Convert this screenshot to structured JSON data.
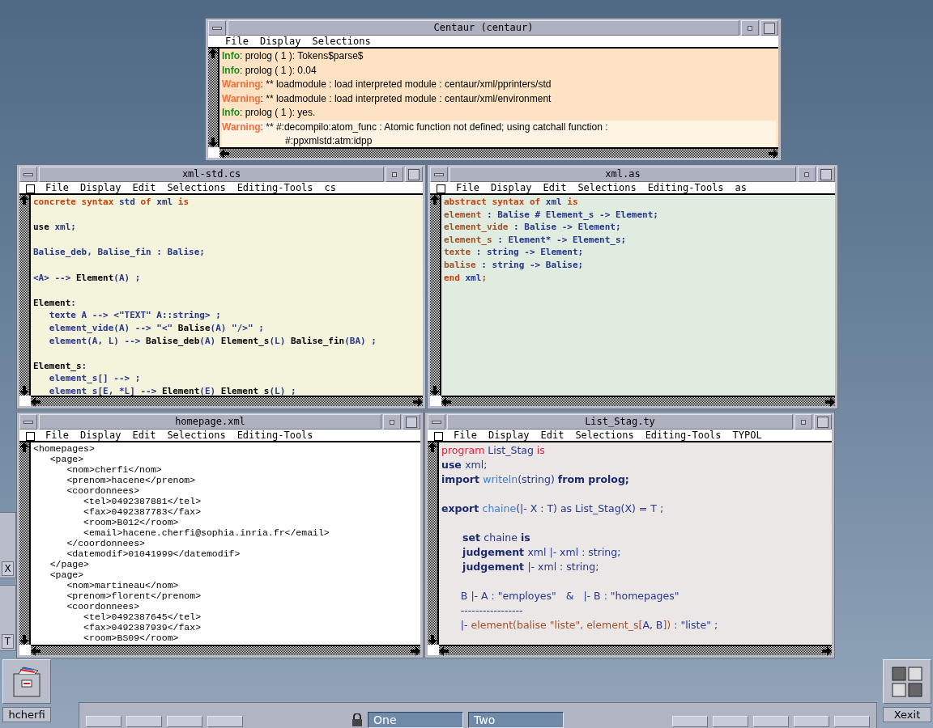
{
  "windows": [
    {
      "title": "Centaur (centaur)",
      "kind": "log",
      "color": "#fde3c4",
      "menu": [
        "File",
        "Display",
        "Selections"
      ],
      "entries": [
        {
          "kind": "info",
          "label": "Info",
          "message": ": prolog ( 1 ): Tokens$parse$",
          "selected": false
        },
        {
          "kind": "info",
          "label": "Info",
          "message": ": prolog ( 1 ): 0.04",
          "selected": false
        },
        {
          "kind": "warning",
          "label": "Warning",
          "message": ": ** loadmodule : load interpreted module : centaur/xml/pprinters/std",
          "selected": false
        },
        {
          "kind": "warning",
          "label": "Warning",
          "message": ": ** loadmodule : load interpreted module : centaur/xml/environment",
          "selected": false
        },
        {
          "kind": "info",
          "label": "Info",
          "message": ": prolog ( 1 ): yes.",
          "selected": false
        },
        {
          "kind": "warning",
          "label": "Warning",
          "message": ": ** #:decompilo:atom_func : Atomic function not defined; using catchall function :",
          "continuation": "#:ppxmlstd:atm:idpp",
          "selected": true
        }
      ]
    },
    {
      "title": "xml-std.cs",
      "kind": "code",
      "color": "#f4f3dc",
      "toggle": {
        "checked": false
      },
      "menu": [
        "File",
        "Display",
        "Edit",
        "Selections",
        "Editing-Tools",
        "cs"
      ],
      "lines": [
        {
          "kind": "text",
          "segments": [
            {
              "kind": "keyword",
              "text": "concrete syntax "
            },
            {
              "kind": "name",
              "text": "std "
            },
            {
              "kind": "keyword",
              "text": "of "
            },
            {
              "kind": "name",
              "text": "xml "
            },
            {
              "kind": "keyword",
              "text": "is"
            }
          ]
        },
        {
          "kind": "blank"
        },
        {
          "kind": "text",
          "segments": [
            {
              "kind": "plain",
              "text": "use "
            },
            {
              "kind": "name",
              "text": "xml;"
            }
          ]
        },
        {
          "kind": "blank"
        },
        {
          "kind": "text",
          "segments": [
            {
              "kind": "name",
              "text": "Balise_deb, Balise_fin : Balise;"
            }
          ]
        },
        {
          "kind": "blank"
        },
        {
          "kind": "text",
          "segments": [
            {
              "kind": "name",
              "text": "<A> --> "
            },
            {
              "kind": "plain",
              "text": "Element"
            },
            {
              "kind": "name",
              "text": "(A) ;"
            }
          ]
        },
        {
          "kind": "blank"
        },
        {
          "kind": "text",
          "segments": [
            {
              "kind": "plain",
              "text": "Element"
            },
            {
              "kind": "name",
              "text": ":"
            }
          ]
        },
        {
          "kind": "text",
          "segments": [
            {
              "kind": "name",
              "text": "   texte A --> <\"TEXT\" A::string> ;"
            }
          ]
        },
        {
          "kind": "text",
          "segments": [
            {
              "kind": "name",
              "text": "   element_vide(A) --> \"<\" "
            },
            {
              "kind": "plain",
              "text": "Balise"
            },
            {
              "kind": "name",
              "text": "(A) \"/>\" ;"
            }
          ]
        },
        {
          "kind": "text",
          "segments": [
            {
              "kind": "name",
              "text": "   element(A, L) --> "
            },
            {
              "kind": "plain",
              "text": "Balise_deb"
            },
            {
              "kind": "name",
              "text": "(A) "
            },
            {
              "kind": "plain",
              "text": "Element_s"
            },
            {
              "kind": "name",
              "text": "(L) "
            },
            {
              "kind": "plain",
              "text": "Balise_fin"
            },
            {
              "kind": "name",
              "text": "(BA) ;"
            }
          ]
        },
        {
          "kind": "blank"
        },
        {
          "kind": "text",
          "segments": [
            {
              "kind": "plain",
              "text": "Element_s"
            },
            {
              "kind": "name",
              "text": ":"
            }
          ]
        },
        {
          "kind": "text",
          "segments": [
            {
              "kind": "name",
              "text": "   element_s[] --> ;"
            }
          ]
        },
        {
          "kind": "text",
          "segments": [
            {
              "kind": "name",
              "text": "   element_s[E, *L] --> "
            },
            {
              "kind": "plain",
              "text": "Element"
            },
            {
              "kind": "name",
              "text": "(E) "
            },
            {
              "kind": "plain",
              "text": "Element_s"
            },
            {
              "kind": "name",
              "text": "(L) ;"
            }
          ]
        }
      ]
    },
    {
      "title": "xml.as",
      "kind": "code",
      "color": "#e0ecdf",
      "toggle": {
        "checked": false
      },
      "menu": [
        "File",
        "Display",
        "Edit",
        "Selections",
        "Editing-Tools",
        "as"
      ],
      "lines": [
        {
          "kind": "text",
          "segments": [
            {
              "kind": "keyword",
              "text": "abstract syntax of "
            },
            {
              "kind": "name",
              "text": "xml "
            },
            {
              "kind": "keyword",
              "text": "is"
            }
          ]
        },
        {
          "kind": "text",
          "segments": [
            {
              "kind": "constructor",
              "text": "element"
            },
            {
              "kind": "name",
              "text": " : Balise # Element_s -> Element;"
            }
          ]
        },
        {
          "kind": "text",
          "segments": [
            {
              "kind": "constructor",
              "text": "element_vide"
            },
            {
              "kind": "name",
              "text": " : Balise -> Element;"
            }
          ]
        },
        {
          "kind": "text",
          "segments": [
            {
              "kind": "constructor",
              "text": "element_s"
            },
            {
              "kind": "name",
              "text": " : Element* -> Element_s;"
            }
          ]
        },
        {
          "kind": "text",
          "segments": [
            {
              "kind": "constructor",
              "text": "texte"
            },
            {
              "kind": "name",
              "text": " : string -> Element;"
            }
          ]
        },
        {
          "kind": "text",
          "segments": [
            {
              "kind": "constructor",
              "text": "balise"
            },
            {
              "kind": "name",
              "text": " : string -> Balise;"
            }
          ]
        },
        {
          "kind": "text",
          "segments": [
            {
              "kind": "keyword",
              "text": "end "
            },
            {
              "kind": "name",
              "text": "xml"
            },
            {
              "kind": "keyword",
              "text": ";"
            }
          ]
        }
      ]
    },
    {
      "title": "homepage.xml",
      "kind": "markup",
      "color": "#ffffff",
      "toggle": {
        "checked": false
      },
      "menu": [
        "File",
        "Display",
        "Edit",
        "Selections",
        "Editing-Tools"
      ],
      "lines": [
        "<homepages>",
        "   <page>",
        "      <nom>cherfi</nom>",
        "      <prenom>hacene</prenom>",
        "      <coordonnees>",
        "         <tel>0492387881</tel>",
        "         <fax>0492387783</fax>",
        "         <room>B012</room>",
        "         <email>hacene.cherfi@sophia.inria.fr</email>",
        "      </coordonnees>",
        "      <datemodif>01041999</datemodif>",
        "   </page>",
        "   <page>",
        "      <nom>martineau</nom>",
        "      <prenom>florent</prenom>",
        "      <coordonnees>",
        "         <tel>0492387645</tel>",
        "         <fax>0492387939</fax>",
        "         <room>BS09</room>"
      ]
    },
    {
      "title": "List_Stag.ty",
      "kind": "typol",
      "color": "#ebe7e6",
      "toggle": {
        "checked": false
      },
      "menu": [
        "File",
        "Display",
        "Edit",
        "Selections",
        "Editing-Tools",
        "TYPOL"
      ],
      "lines": [
        {
          "kind": "text",
          "segments": [
            {
              "kind": "accent",
              "text": "program "
            },
            {
              "kind": "name",
              "text": "List_Stag "
            },
            {
              "kind": "accent",
              "text": "is"
            }
          ]
        },
        {
          "kind": "text",
          "segments": [
            {
              "kind": "strong",
              "text": "use "
            },
            {
              "kind": "name",
              "text": "xml;"
            }
          ]
        },
        {
          "kind": "text",
          "segments": [
            {
              "kind": "strong",
              "text": "import "
            },
            {
              "kind": "light",
              "text": "writeln"
            },
            {
              "kind": "name",
              "text": "(string) "
            },
            {
              "kind": "strong",
              "text": "from prolog;"
            }
          ]
        },
        {
          "kind": "blank"
        },
        {
          "kind": "text",
          "segments": [
            {
              "kind": "strong",
              "text": "export "
            },
            {
              "kind": "light",
              "text": "chaine"
            },
            {
              "kind": "name",
              "text": "(|- X : T) as List_Stag(X) = T ;"
            }
          ]
        },
        {
          "kind": "blank"
        },
        {
          "kind": "text",
          "segments": [
            {
              "kind": "strong",
              "text": "      set "
            },
            {
              "kind": "name",
              "text": "chaine "
            },
            {
              "kind": "strong",
              "text": "is"
            }
          ]
        },
        {
          "kind": "text",
          "segments": [
            {
              "kind": "strong",
              "text": "      judgement "
            },
            {
              "kind": "name",
              "text": "xml |- xml : string;"
            }
          ]
        },
        {
          "kind": "text",
          "segments": [
            {
              "kind": "strong",
              "text": "      judgement "
            },
            {
              "kind": "name",
              "text": "|- xml : string;"
            }
          ]
        },
        {
          "kind": "blank"
        },
        {
          "kind": "text",
          "segments": [
            {
              "kind": "name",
              "text": "      B |- A : \"employes\"   &   |- B : \"homepages\""
            }
          ]
        },
        {
          "kind": "text",
          "segments": [
            {
              "kind": "name",
              "text": "      -----------------"
            }
          ]
        },
        {
          "kind": "text",
          "segments": [
            {
              "kind": "name",
              "text": "      |- "
            },
            {
              "kind": "constructor",
              "text": "element(balise \"liste\", element_s["
            },
            {
              "kind": "name",
              "text": "A, B"
            },
            {
              "kind": "constructor",
              "text": "])"
            },
            {
              "kind": "name",
              "text": " : \"liste\" ;"
            }
          ]
        }
      ]
    }
  ],
  "edge_stubs": [
    {
      "label": "X"
    },
    {
      "label": "T"
    }
  ],
  "desktop_icons": [
    {
      "kind": "drawer",
      "label": "hcherfi"
    },
    {
      "kind": "grid",
      "label": "Xexit"
    }
  ],
  "front_panel": {
    "workspaces": [
      {
        "label": "One"
      },
      {
        "label": "Two"
      }
    ]
  }
}
